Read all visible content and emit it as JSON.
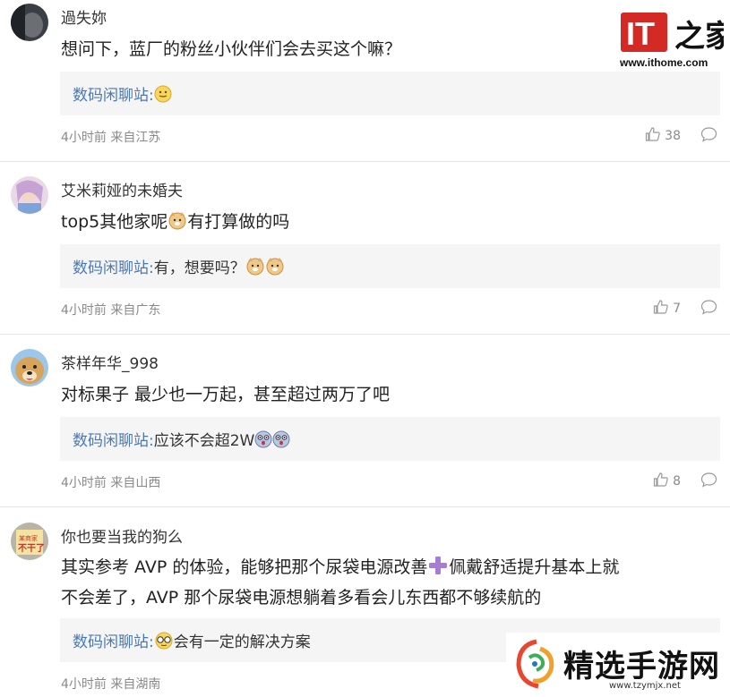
{
  "watermark": {
    "it_url": "www.ithome.com",
    "site_title": "精选手游网",
    "site_url": "www.tzymjx.net"
  },
  "comments": [
    {
      "username": "過失妳",
      "text": "想问下，蓝厂的粉丝小伙伴们会去买这个嘛？",
      "reply_author": "数码闲聊站:",
      "reply_text": "",
      "reply_emoji": "smile-emoji",
      "time": "4小时前",
      "location": "来自江苏",
      "likes": "38"
    },
    {
      "username": "艾米莉娅的未婚夫",
      "text_before": "top5其他家呢",
      "text_after": "有打算做的吗",
      "reply_author": "数码闲聊站:",
      "reply_text": "有，想要吗？",
      "time": "4小时前",
      "location": "来自广东",
      "likes": "7"
    },
    {
      "username": "茶样年华_998",
      "text": "对标果子 最少也一万起，甚至超过两万了吧",
      "reply_author": "数码闲聊站:",
      "reply_text": "应该不会超2W",
      "time": "4小时前",
      "location": "来自山西",
      "likes": "8"
    },
    {
      "username": "你也要当我的狗么",
      "text_line1_before": "其实参考 AVP 的体验，能够把那个尿袋电源改善",
      "text_line1_after": "佩戴舒适提升基本上就",
      "text_line2": "不会差了，AVP 那个尿袋电源想躺着多看会儿东西都不够续航的",
      "reply_author": "数码闲聊站:",
      "reply_text": "会有一定的解决方案",
      "time": "4小时前",
      "location": "来自湖南"
    }
  ],
  "colors": {
    "reply_author": "#4a7ab5",
    "meta": "#8a8a8a",
    "reply_bg": "#f5f5f5",
    "it_red": "#d32a26"
  }
}
